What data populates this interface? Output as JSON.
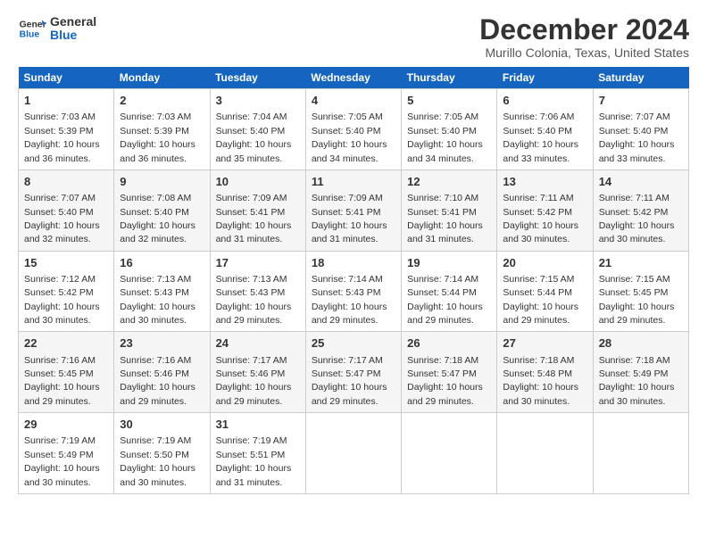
{
  "logo": {
    "line1": "General",
    "line2": "Blue"
  },
  "title": "December 2024",
  "subtitle": "Murillo Colonia, Texas, United States",
  "days_of_week": [
    "Sunday",
    "Monday",
    "Tuesday",
    "Wednesday",
    "Thursday",
    "Friday",
    "Saturday"
  ],
  "weeks": [
    [
      {
        "day": "1",
        "info": "Sunrise: 7:03 AM\nSunset: 5:39 PM\nDaylight: 10 hours\nand 36 minutes."
      },
      {
        "day": "2",
        "info": "Sunrise: 7:03 AM\nSunset: 5:39 PM\nDaylight: 10 hours\nand 36 minutes."
      },
      {
        "day": "3",
        "info": "Sunrise: 7:04 AM\nSunset: 5:40 PM\nDaylight: 10 hours\nand 35 minutes."
      },
      {
        "day": "4",
        "info": "Sunrise: 7:05 AM\nSunset: 5:40 PM\nDaylight: 10 hours\nand 34 minutes."
      },
      {
        "day": "5",
        "info": "Sunrise: 7:05 AM\nSunset: 5:40 PM\nDaylight: 10 hours\nand 34 minutes."
      },
      {
        "day": "6",
        "info": "Sunrise: 7:06 AM\nSunset: 5:40 PM\nDaylight: 10 hours\nand 33 minutes."
      },
      {
        "day": "7",
        "info": "Sunrise: 7:07 AM\nSunset: 5:40 PM\nDaylight: 10 hours\nand 33 minutes."
      }
    ],
    [
      {
        "day": "8",
        "info": "Sunrise: 7:07 AM\nSunset: 5:40 PM\nDaylight: 10 hours\nand 32 minutes."
      },
      {
        "day": "9",
        "info": "Sunrise: 7:08 AM\nSunset: 5:40 PM\nDaylight: 10 hours\nand 32 minutes."
      },
      {
        "day": "10",
        "info": "Sunrise: 7:09 AM\nSunset: 5:41 PM\nDaylight: 10 hours\nand 31 minutes."
      },
      {
        "day": "11",
        "info": "Sunrise: 7:09 AM\nSunset: 5:41 PM\nDaylight: 10 hours\nand 31 minutes."
      },
      {
        "day": "12",
        "info": "Sunrise: 7:10 AM\nSunset: 5:41 PM\nDaylight: 10 hours\nand 31 minutes."
      },
      {
        "day": "13",
        "info": "Sunrise: 7:11 AM\nSunset: 5:42 PM\nDaylight: 10 hours\nand 30 minutes."
      },
      {
        "day": "14",
        "info": "Sunrise: 7:11 AM\nSunset: 5:42 PM\nDaylight: 10 hours\nand 30 minutes."
      }
    ],
    [
      {
        "day": "15",
        "info": "Sunrise: 7:12 AM\nSunset: 5:42 PM\nDaylight: 10 hours\nand 30 minutes."
      },
      {
        "day": "16",
        "info": "Sunrise: 7:13 AM\nSunset: 5:43 PM\nDaylight: 10 hours\nand 30 minutes."
      },
      {
        "day": "17",
        "info": "Sunrise: 7:13 AM\nSunset: 5:43 PM\nDaylight: 10 hours\nand 29 minutes."
      },
      {
        "day": "18",
        "info": "Sunrise: 7:14 AM\nSunset: 5:43 PM\nDaylight: 10 hours\nand 29 minutes."
      },
      {
        "day": "19",
        "info": "Sunrise: 7:14 AM\nSunset: 5:44 PM\nDaylight: 10 hours\nand 29 minutes."
      },
      {
        "day": "20",
        "info": "Sunrise: 7:15 AM\nSunset: 5:44 PM\nDaylight: 10 hours\nand 29 minutes."
      },
      {
        "day": "21",
        "info": "Sunrise: 7:15 AM\nSunset: 5:45 PM\nDaylight: 10 hours\nand 29 minutes."
      }
    ],
    [
      {
        "day": "22",
        "info": "Sunrise: 7:16 AM\nSunset: 5:45 PM\nDaylight: 10 hours\nand 29 minutes."
      },
      {
        "day": "23",
        "info": "Sunrise: 7:16 AM\nSunset: 5:46 PM\nDaylight: 10 hours\nand 29 minutes."
      },
      {
        "day": "24",
        "info": "Sunrise: 7:17 AM\nSunset: 5:46 PM\nDaylight: 10 hours\nand 29 minutes."
      },
      {
        "day": "25",
        "info": "Sunrise: 7:17 AM\nSunset: 5:47 PM\nDaylight: 10 hours\nand 29 minutes."
      },
      {
        "day": "26",
        "info": "Sunrise: 7:18 AM\nSunset: 5:47 PM\nDaylight: 10 hours\nand 29 minutes."
      },
      {
        "day": "27",
        "info": "Sunrise: 7:18 AM\nSunset: 5:48 PM\nDaylight: 10 hours\nand 30 minutes."
      },
      {
        "day": "28",
        "info": "Sunrise: 7:18 AM\nSunset: 5:49 PM\nDaylight: 10 hours\nand 30 minutes."
      }
    ],
    [
      {
        "day": "29",
        "info": "Sunrise: 7:19 AM\nSunset: 5:49 PM\nDaylight: 10 hours\nand 30 minutes."
      },
      {
        "day": "30",
        "info": "Sunrise: 7:19 AM\nSunset: 5:50 PM\nDaylight: 10 hours\nand 30 minutes."
      },
      {
        "day": "31",
        "info": "Sunrise: 7:19 AM\nSunset: 5:51 PM\nDaylight: 10 hours\nand 31 minutes."
      },
      {
        "day": "",
        "info": ""
      },
      {
        "day": "",
        "info": ""
      },
      {
        "day": "",
        "info": ""
      },
      {
        "day": "",
        "info": ""
      }
    ]
  ]
}
